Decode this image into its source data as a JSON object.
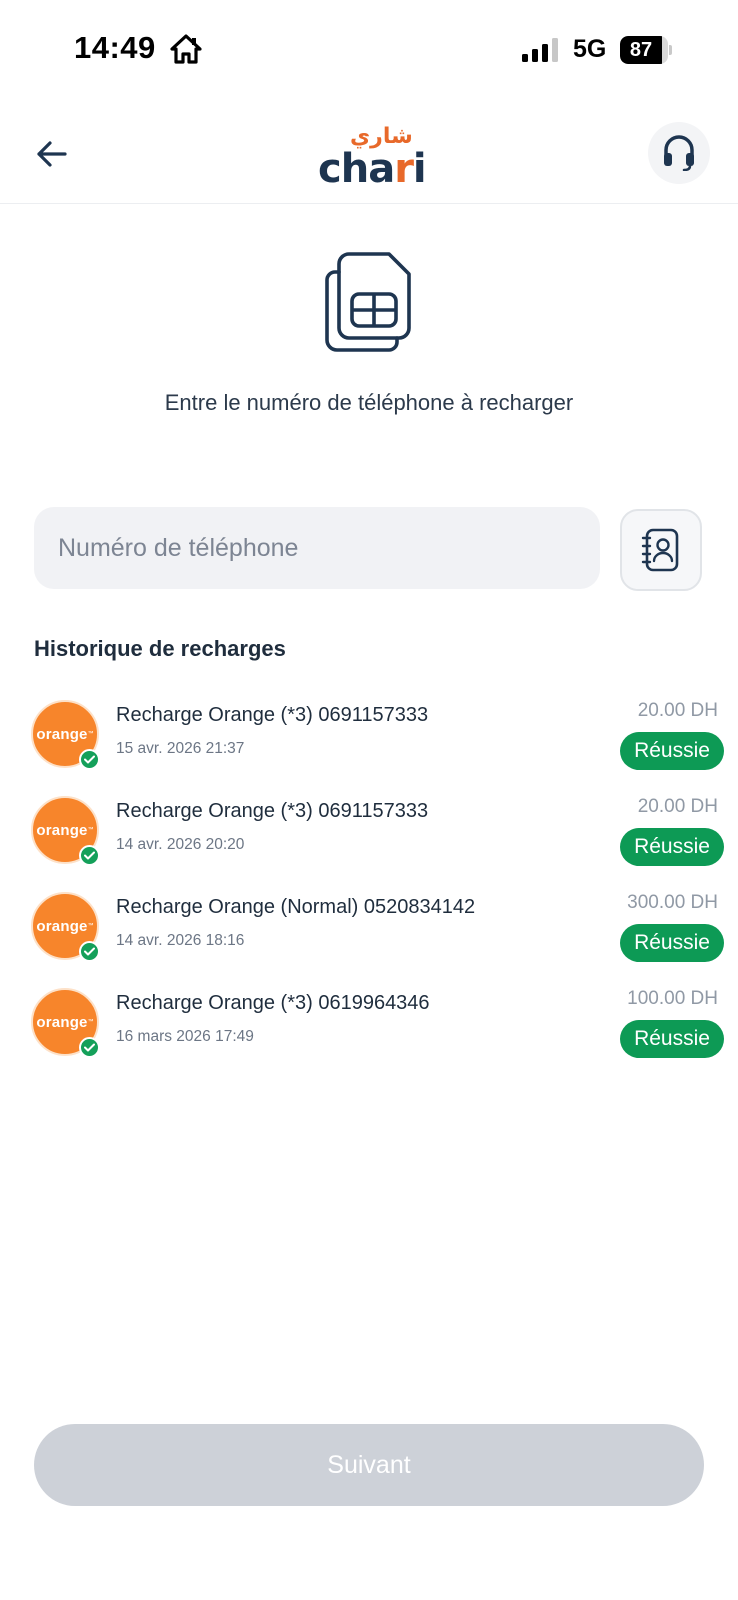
{
  "status_bar": {
    "time": "14:49",
    "network": "5G",
    "battery_level": "87",
    "battery_fraction": 0.87
  },
  "header": {
    "back_icon": "arrow-left-icon",
    "logo_latin_prefix": "cha",
    "logo_latin_accent": "r",
    "logo_latin_suffix": "i",
    "logo_arabic": "شاري",
    "support_icon": "headset-icon"
  },
  "colors": {
    "brand_navy": "#1e3550",
    "brand_orange": "#e8692a",
    "success_green": "#0d9a55",
    "operator_orange": "#f7852b",
    "disabled_button": "#cdd1d8"
  },
  "hero": {
    "icon": "sim-card-icon",
    "instruction": "Entre le numéro de téléphone à recharger"
  },
  "phone_input": {
    "placeholder": "Numéro de téléphone",
    "value": "",
    "contacts_icon": "contacts-book-icon"
  },
  "history": {
    "title": "Historique de recharges",
    "items": [
      {
        "operator": "orange",
        "title": "Recharge Orange (*3) 0691157333",
        "date": "15 avr. 2026 21:37",
        "amount": "20.00 DH",
        "status": "Réussie"
      },
      {
        "operator": "orange",
        "title": "Recharge Orange (*3) 0691157333",
        "date": "14 avr. 2026 20:20",
        "amount": "20.00 DH",
        "status": "Réussie"
      },
      {
        "operator": "orange",
        "title": "Recharge Orange (Normal) 0520834142",
        "date": "14 avr. 2026 18:16",
        "amount": "300.00 DH",
        "status": "Réussie"
      },
      {
        "operator": "orange",
        "title": "Recharge Orange (*3) 0619964346",
        "date": "16 mars 2026 17:49",
        "amount": "100.00 DH",
        "status": "Réussie"
      }
    ]
  },
  "footer": {
    "next_label": "Suivant",
    "next_enabled": false
  }
}
